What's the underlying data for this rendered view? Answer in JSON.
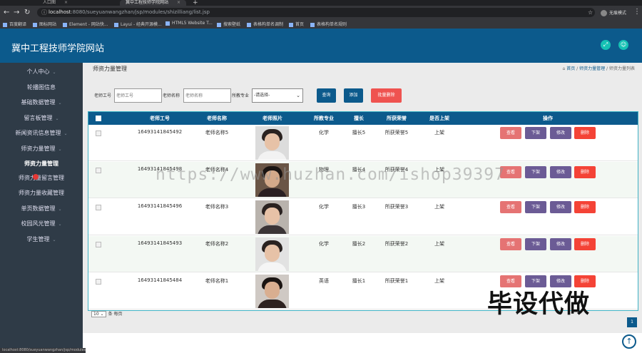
{
  "browser": {
    "tabs": [
      {
        "label": "人口图"
      },
      {
        "label": "冀中工程技师学院网站",
        "active": true
      }
    ],
    "url_host": "localhost",
    "url_path": ":8080/sueyuanwangzhan/jsp/modules/shizilliang/list.jsp",
    "profile_label": "无痕模式",
    "bookmarks": [
      "百度翻译",
      "图标网站",
      "Element - 网站快...",
      "Layui - 经典开源模...",
      "HTML5 Website T...",
      "搜索壁纸",
      "表格构单名调制",
      "首页",
      "表格构单名规则"
    ]
  },
  "header": {
    "site_title": "冀中工程技师学院网站"
  },
  "sidebar": {
    "items": [
      {
        "label": "个人中心",
        "arrow": true
      },
      {
        "label": "轮播图信息"
      },
      {
        "label": "基础数据管理",
        "arrow": true
      },
      {
        "label": "留言板管理",
        "arrow": true
      },
      {
        "label": "新闻资讯信息管理",
        "arrow": true
      },
      {
        "label": "师资力量管理",
        "arrow": true
      },
      {
        "label": "师资力量管理",
        "active": true
      },
      {
        "label": "师资力量留言管理"
      },
      {
        "label": "师资力量收藏管理"
      },
      {
        "label": "单页数据管理",
        "arrow": true
      },
      {
        "label": "校园风光管理",
        "arrow": true
      },
      {
        "label": "学生管理",
        "arrow": true
      }
    ]
  },
  "page": {
    "title": "师资力量管理",
    "breadcrumb": {
      "home": "首页",
      "sep": "/",
      "section": "师资力量管理",
      "current": "师资力量列表"
    }
  },
  "search": {
    "teacher_no_label": "老师工号",
    "teacher_no_placeholder": "老师工号",
    "teacher_name_label": "老师名称",
    "teacher_name_placeholder": "老师名称",
    "major_label": "所教专业",
    "major_selected": "-请选择-",
    "search_button": "查询",
    "add_button": "添加",
    "batch_delete_button": "批量删除"
  },
  "table": {
    "headers": [
      "老师工号",
      "老师名称",
      "老师照片",
      "所教专业",
      "擅长",
      "所获荣誉",
      "是否上架",
      "操作"
    ],
    "rows": [
      {
        "no": "16493141845492",
        "name": "老师名称5",
        "major": "化学",
        "skill": "擅长5",
        "honor": "所获荣誉5",
        "status": "上架"
      },
      {
        "no": "16493141845498",
        "name": "老师名称4",
        "major": "物理",
        "skill": "擅长4",
        "honor": "所获荣誉4",
        "status": "上架"
      },
      {
        "no": "16493141845496",
        "name": "老师名称3",
        "major": "化学",
        "skill": "擅长3",
        "honor": "所获荣誉3",
        "status": "上架"
      },
      {
        "no": "16493141845493",
        "name": "老师名称2",
        "major": "化学",
        "skill": "擅长2",
        "honor": "所获荣誉2",
        "status": "上架"
      },
      {
        "no": "16493141845484",
        "name": "老师名称1",
        "major": "英语",
        "skill": "擅长1",
        "honor": "所获荣誉1",
        "status": "上架"
      }
    ],
    "actions": {
      "view": "查看",
      "off": "下架",
      "edit": "修改",
      "delete": "删除"
    }
  },
  "pagination": {
    "page_size": "10",
    "per_page_label": "条 每页",
    "current_page": "1"
  },
  "overlays": {
    "watermark": "https://www.huzhan.com/ishop39397",
    "stamp": "毕设代做"
  },
  "colors": {
    "primary": "#0c5a8c",
    "sidebar": "#2f3b47",
    "teal": "#16c1b4",
    "danger": "#f44336",
    "purple": "#6b5b95"
  }
}
